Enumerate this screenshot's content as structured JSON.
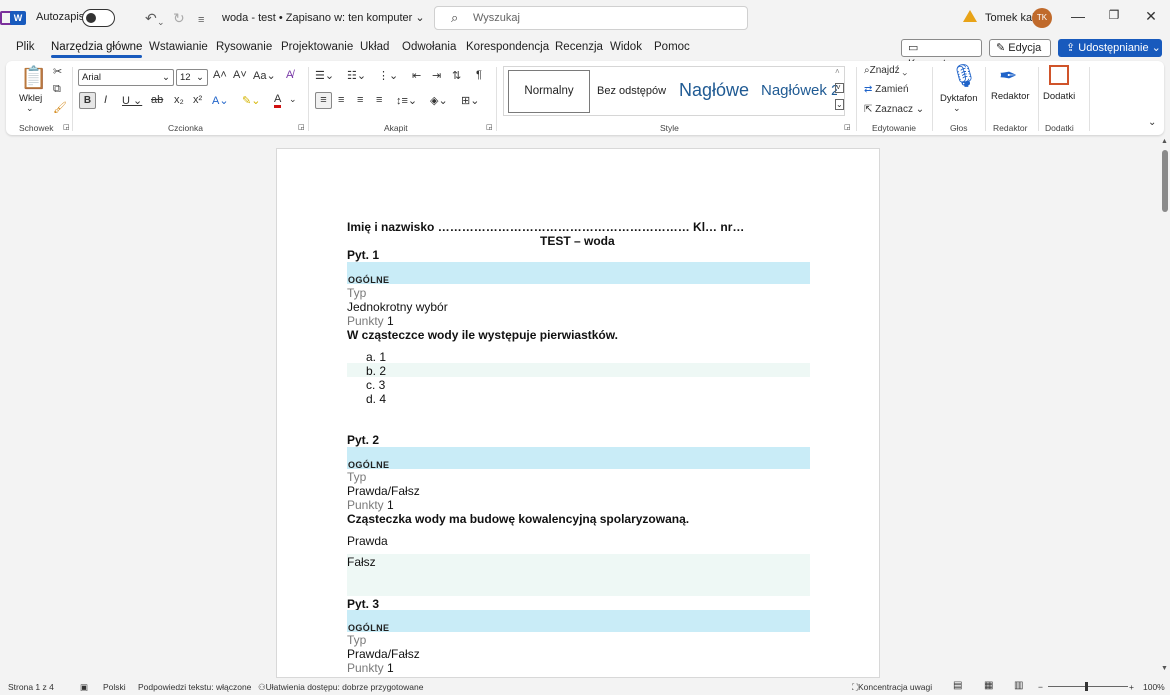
{
  "titlebar": {
    "autosave_label": "Autozapis",
    "doc_title": "woda - test • Zapisano w: ten komputer",
    "search_placeholder": "Wyszukaj",
    "user_name": "Tomek kal",
    "avatar_initials": "TK"
  },
  "menu": {
    "tabs": [
      "Plik",
      "Narzędzia główne",
      "Wstawianie",
      "Rysowanie",
      "Projektowanie",
      "Układ",
      "Odwołania",
      "Korespondencja",
      "Recenzja",
      "Widok",
      "Pomoc"
    ],
    "active": "Narzędzia główne",
    "comments": "Komentarze",
    "editing": "Edycja",
    "share": "Udostępnianie"
  },
  "ribbon": {
    "paste_label": "Wklej",
    "font_name": "Arial",
    "font_size": "12",
    "styles": [
      "Normalny",
      "Bez odstępów",
      "Nagłówe",
      "Nagłówek 2"
    ],
    "find": "Znajdź",
    "replace": "Zamień",
    "select": "Zaznacz",
    "dictate": "Dyktafon",
    "editor": "Redaktor",
    "addins": "Dodatki",
    "groups": {
      "clipboard": "Schowek",
      "font": "Czcionka",
      "paragraph": "Akapit",
      "styles": "Style",
      "editing": "Edytowanie",
      "voice": "Głos",
      "editor": "Redaktor",
      "addins": "Dodatki"
    }
  },
  "document": {
    "name_line": "Imię i nazwisko ……………………………………………………… Kl… nr…",
    "test_title": "TEST – woda",
    "q1": {
      "title": "Pyt. 1",
      "section": "OGÓLNE",
      "type_label": "Typ",
      "type_value": "Jednokrotny wybór",
      "points_label": "Punkty",
      "points_value": "1",
      "question": "W cząsteczce wody ile występuje pierwiastków.",
      "answers": [
        "a.  1",
        "b.  2",
        "c.  3",
        "d.  4"
      ]
    },
    "q2": {
      "title": "Pyt. 2",
      "section": "OGÓLNE",
      "type_label": "Typ",
      "type_value": "Prawda/Fałsz",
      "points_label": "Punkty",
      "points_value": "1",
      "question": "Cząsteczka wody ma budowę kowalencyjną spolaryzowaną.",
      "true_label": "Prawda",
      "false_label": "Fałsz"
    },
    "q3": {
      "title": "Pyt. 3",
      "section": "OGÓLNE",
      "type_label": "Typ",
      "type_value": "Prawda/Fałsz",
      "points_label": "Punkty",
      "points_value": "1"
    }
  },
  "statusbar": {
    "page": "Strona 1 z 4",
    "language": "Polski",
    "predictions": "Podpowiedzi tekstu: włączone",
    "accessibility": "Ułatwienia dostępu: dobrze przygotowane",
    "focus": "Koncentracja uwagi",
    "zoom": "100%"
  },
  "colors": {
    "accent": "#185abd",
    "band": "#c9ecf7",
    "light_band": "#eef8f5"
  }
}
